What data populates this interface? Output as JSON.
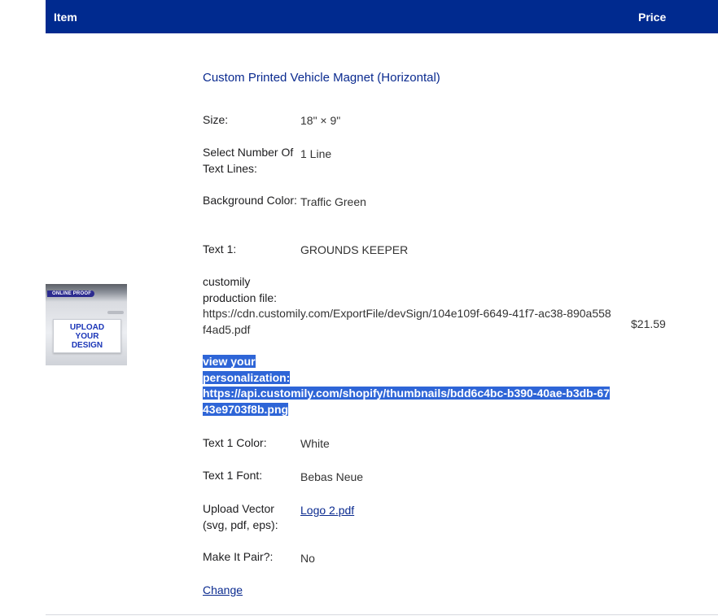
{
  "header": {
    "item_label": "Item",
    "price_label": "Price"
  },
  "thumbnail": {
    "badge": "ONLINE PROOF",
    "card_line1": "UPLOAD",
    "card_line2": "YOUR",
    "card_line3": "DESIGN"
  },
  "product": {
    "title": "Custom Printed Vehicle Magnet (Horizontal)",
    "price": "$21.59",
    "options": {
      "size_label": "Size:",
      "size_value": "18\" × 9\"",
      "lines_label": "Select Number Of Text Lines:",
      "lines_value": "1 Line",
      "bg_label": "Background Color:",
      "bg_value": "Traffic Green",
      "text1_label": "Text 1:",
      "text1_value": "GROUNDS KEEPER",
      "production_label": "customily production file:",
      "production_value": "https://cdn.customily.com/ExportFile/devSign/104e109f-6649-41f7-ac38-890a558f4ad5.pdf",
      "view_label": "view your personalization:",
      "view_value": "https://api.customily.com/shopify/thumbnails/bdd6c4bc-b390-40ae-b3db-6743e9703f8b.png",
      "text1color_label": "Text 1 Color:",
      "text1color_value": "White",
      "text1font_label": "Text 1 Font:",
      "text1font_value": "Bebas Neue",
      "vector_label": "Upload Vector (svg, pdf, eps):",
      "vector_value": "Logo 2.pdf",
      "pair_label": "Make It Pair?:",
      "pair_value": "No"
    },
    "change_link": "Change"
  }
}
